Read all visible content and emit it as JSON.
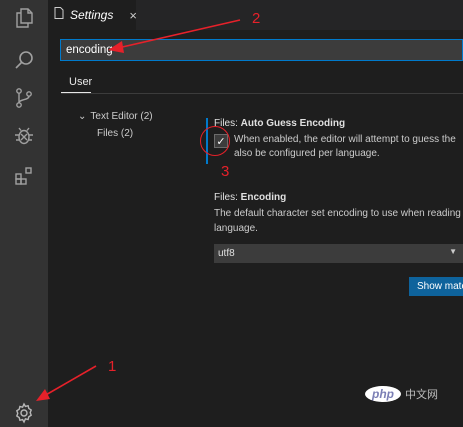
{
  "activity_bar": {
    "icons": [
      "explorer-icon",
      "search-icon",
      "source-control-icon",
      "debug-icon",
      "extensions-icon",
      "settings-gear-icon"
    ]
  },
  "editor_tab": {
    "title": "Settings",
    "close": "×"
  },
  "search": {
    "value": "encoding"
  },
  "scope": {
    "user_tab": "User"
  },
  "toc": {
    "text_editor": "Text Editor (2)",
    "files": "Files (2)",
    "chevron": "⌄"
  },
  "settings": {
    "auto_guess": {
      "category": "Files: ",
      "name": "Auto Guess Encoding",
      "checked": true,
      "check_mark": "✓",
      "description_line1": "When enabled, the editor will attempt to guess the",
      "description_line2": "also be configured per language."
    },
    "encoding": {
      "category": "Files: ",
      "name": "Encoding",
      "description_line1": "The default character set encoding to use when reading",
      "description_line2": "language.",
      "selected_value": "utf8",
      "chevron": "▼"
    },
    "show_button": "Show mate"
  },
  "annotations": {
    "label_1": "1",
    "label_2": "2",
    "label_3": "3",
    "color": "#e6212a"
  },
  "watermark": {
    "logo": "php",
    "site": "中文网"
  },
  "colors": {
    "accent": "#007acc",
    "button": "#0e639c",
    "background": "#1e1e1e",
    "activity_bar": "#333333"
  }
}
